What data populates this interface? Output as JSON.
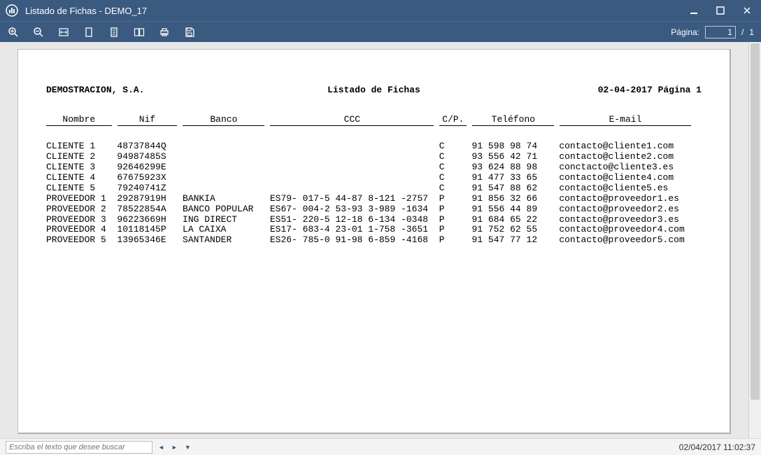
{
  "window": {
    "title": "Listado de Fichas - DEMO_17"
  },
  "toolbar": {
    "page_label": "Página:",
    "page_current": "1",
    "page_sep": "/",
    "page_total": "1"
  },
  "report": {
    "company": "DEMOSTRACION, S.A.",
    "title": "Listado de Fichas",
    "date_page": "02-04-2017 Página 1",
    "columns": {
      "nombre": "Nombre",
      "nif": "Nif",
      "banco": "Banco",
      "ccc": "CCC",
      "cp": "C/P.",
      "telefono": "Teléfono",
      "email": "E-mail"
    },
    "rows": [
      {
        "nombre": "CLIENTE 1",
        "nif": "48737844Q",
        "banco": "",
        "ccc": "",
        "cp": "C",
        "tel": "91 598 98 74",
        "email": "contacto@cliente1.com"
      },
      {
        "nombre": "CLIENTE 2",
        "nif": "94987485S",
        "banco": "",
        "ccc": "",
        "cp": "C",
        "tel": "93 556 42 71",
        "email": "contacto@cliente2.com"
      },
      {
        "nombre": "CLIENTE 3",
        "nif": "92646299E",
        "banco": "",
        "ccc": "",
        "cp": "C",
        "tel": "93 624 88 98",
        "email": "conctacto@cliente3.es"
      },
      {
        "nombre": "CLIENTE 4",
        "nif": "67675923X",
        "banco": "",
        "ccc": "",
        "cp": "C",
        "tel": "91 477 33 65",
        "email": "contacto@cliente4.com"
      },
      {
        "nombre": "CLIENTE 5",
        "nif": "79240741Z",
        "banco": "",
        "ccc": "",
        "cp": "C",
        "tel": "91 547 88 62",
        "email": "contacto@cliente5.es"
      },
      {
        "nombre": "PROVEEDOR 1",
        "nif": "29287919H",
        "banco": "BANKIA",
        "ccc": "ES79- 017-5 44-87 8-121 -2757",
        "cp": "P",
        "tel": "91 856 32 66",
        "email": "contacto@proveedor1.es"
      },
      {
        "nombre": "PROVEEDOR 2",
        "nif": "78522854A",
        "banco": "BANCO POPULAR",
        "ccc": "ES67- 004-2 53-93 3-989 -1634",
        "cp": "P",
        "tel": "91 556 44 89",
        "email": "contacto@proveedor2.es"
      },
      {
        "nombre": "PROVEEDOR 3",
        "nif": "96223669H",
        "banco": "ING DIRECT",
        "ccc": "ES51- 220-5 12-18 6-134 -0348",
        "cp": "P",
        "tel": "91 684 65 22",
        "email": "contacto@proveedor3.es"
      },
      {
        "nombre": "PROVEEDOR 4",
        "nif": "10118145P",
        "banco": "LA CAIXA",
        "ccc": "ES17- 683-4 23-01 1-758 -3651",
        "cp": "P",
        "tel": "91 752 62 55",
        "email": "contacto@proveedor4.com"
      },
      {
        "nombre": "PROVEEDOR 5",
        "nif": "13965346E",
        "banco": "SANTANDER",
        "ccc": "ES26- 785-0 91-98 6-859 -4168",
        "cp": "P",
        "tel": "91 547 77 12",
        "email": "contacto@proveedor5.com"
      }
    ]
  },
  "status": {
    "search_placeholder": "Escriba el texto que desee buscar",
    "datetime": "02/04/2017 11:02:37"
  }
}
